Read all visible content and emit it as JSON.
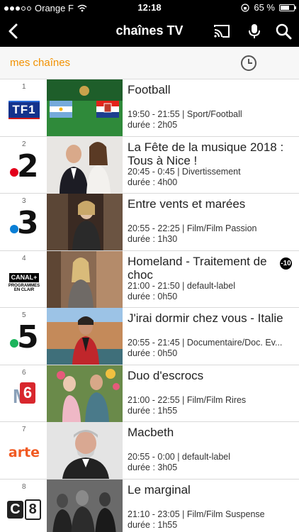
{
  "status_bar": {
    "carrier": "Orange F",
    "time": "12:18",
    "battery": "65 %",
    "battery_level": 0.65
  },
  "header": {
    "title": "chaînes TV",
    "icons": [
      "back-icon",
      "cast-icon",
      "microphone-icon",
      "search-icon"
    ]
  },
  "subbar": {
    "tab_label": "mes chaînes",
    "icons": [
      "clock-icon",
      "moon-icon"
    ]
  },
  "colors": {
    "accent": "#f29100",
    "header_bg": "#000000"
  },
  "channels": [
    {
      "number": "1",
      "logo": "TF1",
      "title": "Football",
      "time": "19:50 - 21:55 | Sport/Football",
      "duration": "durée : 2h05"
    },
    {
      "number": "2",
      "logo": "2",
      "title": "La Fête de la musique 2018 : Tous à Nice !",
      "time": "20:45 - 0:45 | Divertissement",
      "duration": "durée : 4h00"
    },
    {
      "number": "3",
      "logo": "3",
      "title": "Entre vents et marées",
      "time": "20:55 - 22:25 | Film/Film Passion",
      "duration": "durée : 1h30"
    },
    {
      "number": "4",
      "logo": "CANAL+",
      "logo_sub": "PROGRAMMES EN CLAIR",
      "title": "Homeland - Traitement de choc",
      "time": "21:00 - 21:50 | default-label",
      "duration": "durée : 0h50",
      "badge": "-10"
    },
    {
      "number": "5",
      "logo": "5",
      "title": "J'irai dormir chez vous - Italie",
      "time": "20:55 - 21:45 | Documentaire/Doc. Ev...",
      "duration": "durée : 0h50"
    },
    {
      "number": "6",
      "logo": "M6",
      "title": "Duo d'escrocs",
      "time": "21:00 - 22:55 | Film/Film Rires",
      "duration": "durée : 1h55"
    },
    {
      "number": "7",
      "logo": "arte",
      "title": "Macbeth",
      "time": "20:55 - 0:00 | default-label",
      "duration": "durée : 3h05"
    },
    {
      "number": "8",
      "logo": "C8",
      "title": "Le marginal",
      "time": "21:10 - 23:05 | Film/Film Suspense",
      "duration": "durée : 1h55"
    }
  ]
}
